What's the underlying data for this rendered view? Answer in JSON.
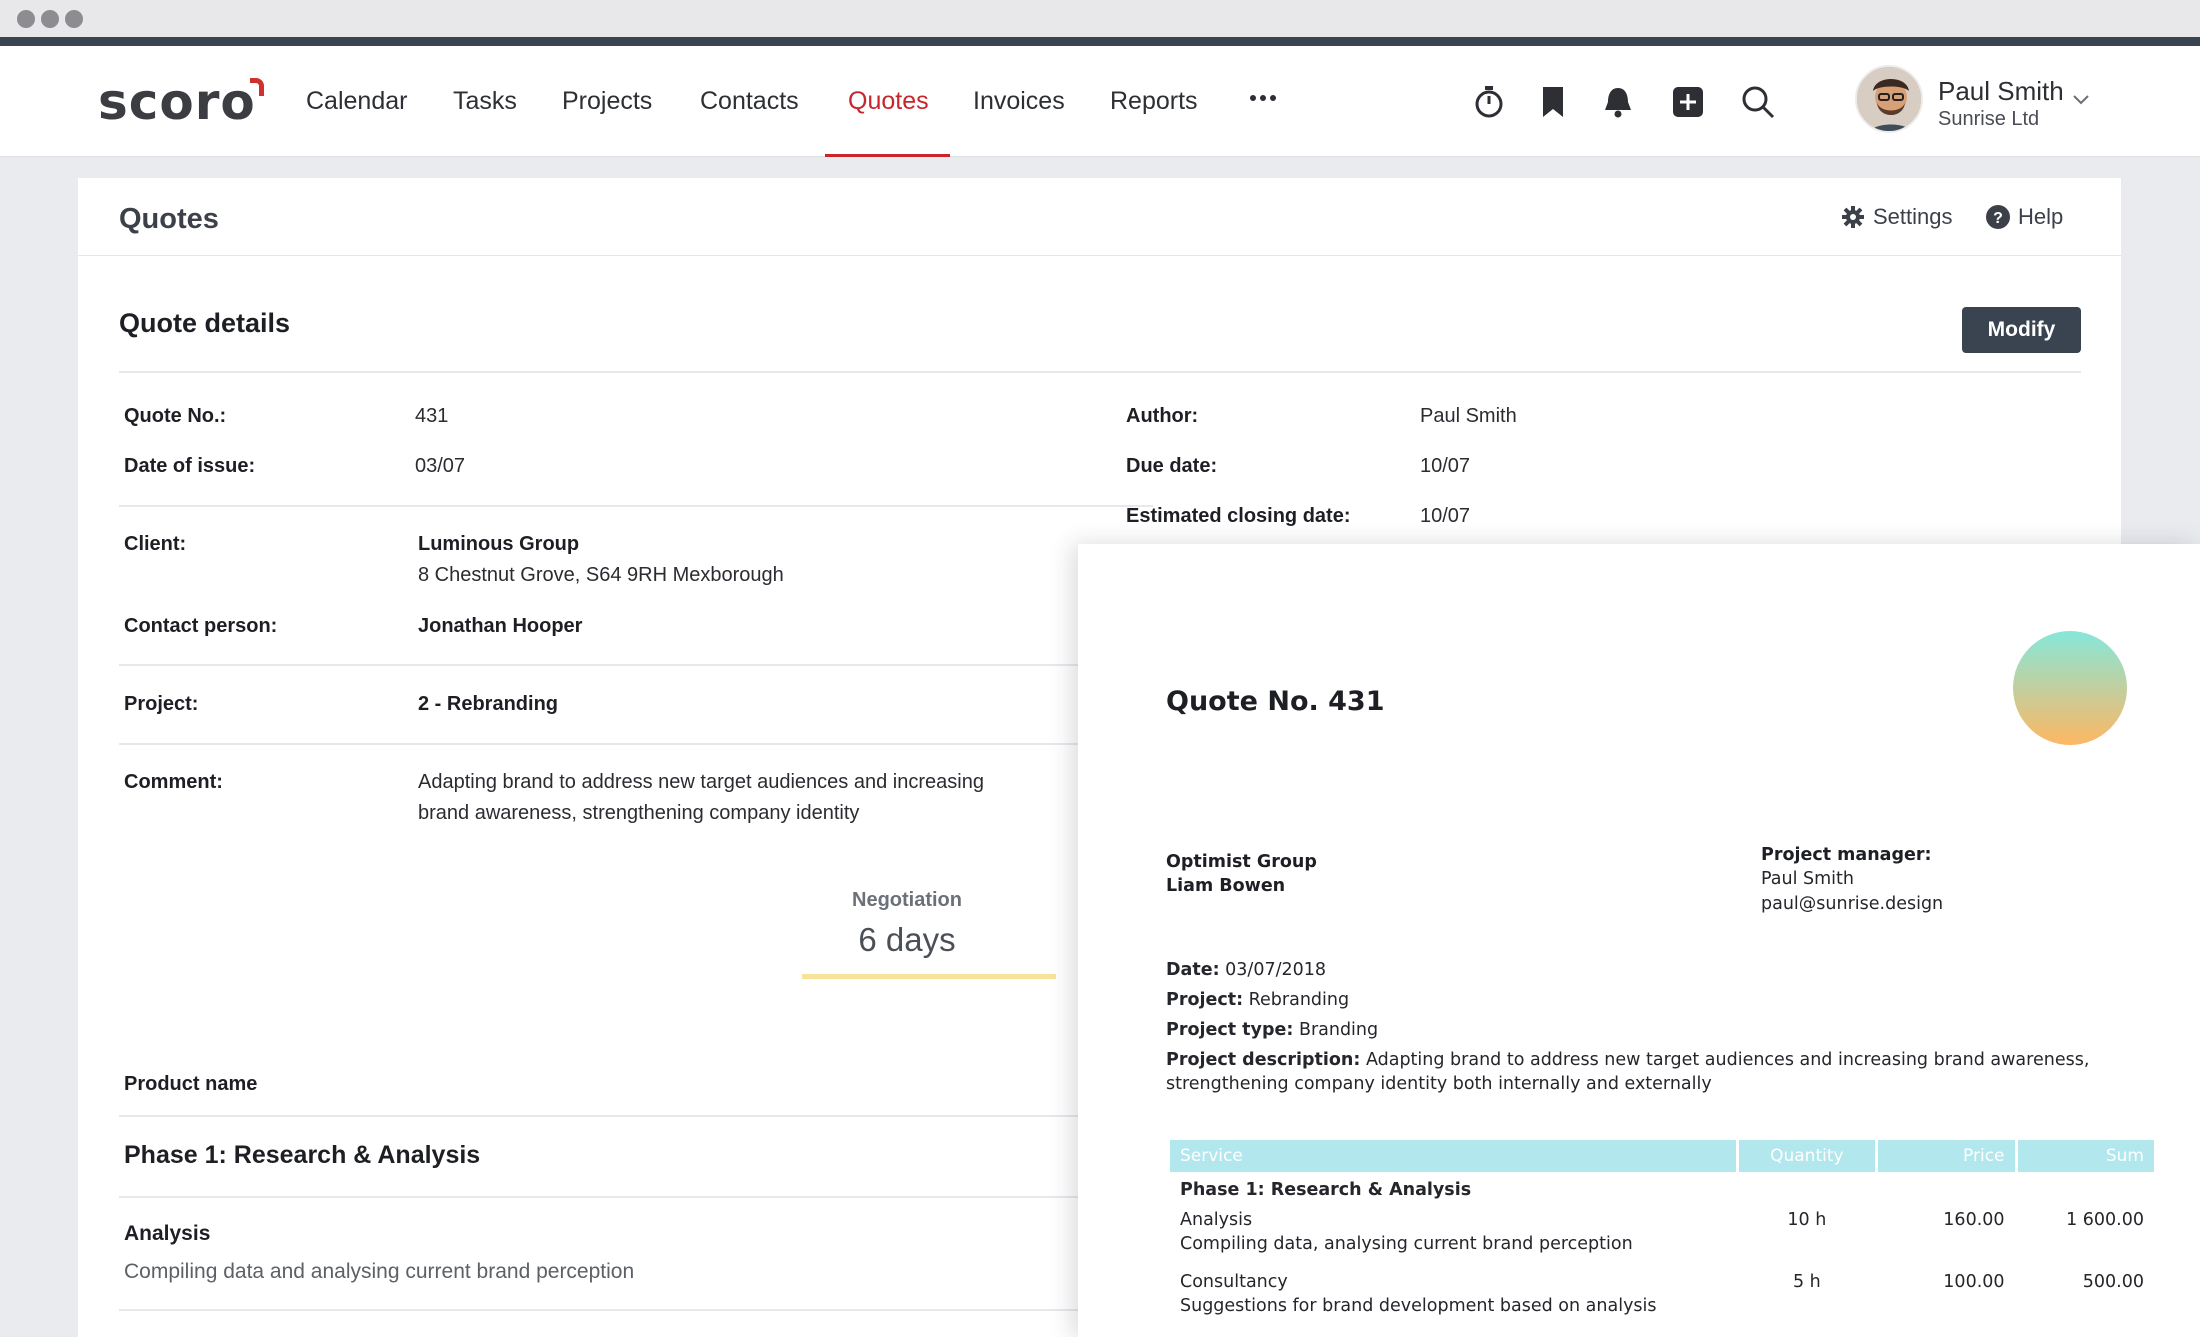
{
  "app": {
    "logo": "scoro"
  },
  "nav": {
    "items": [
      {
        "label": "Calendar"
      },
      {
        "label": "Tasks"
      },
      {
        "label": "Projects"
      },
      {
        "label": "Contacts"
      },
      {
        "label": "Quotes",
        "active": true
      },
      {
        "label": "Invoices"
      },
      {
        "label": "Reports"
      }
    ],
    "more_icon": "ellipsis-icon",
    "tools": [
      "timer-icon",
      "bookmark-icon",
      "bell-icon",
      "add-icon",
      "search-icon"
    ]
  },
  "user": {
    "name": "Paul Smith",
    "company": "Sunrise Ltd"
  },
  "page": {
    "title": "Quotes",
    "settings_label": "Settings",
    "help_label": "Help"
  },
  "details": {
    "title": "Quote details",
    "modify_label": "Modify",
    "quote_no_label": "Quote No.:",
    "quote_no": "431",
    "date_of_issue_label": "Date of issue:",
    "date_of_issue": "03/07",
    "author_label": "Author:",
    "author": "Paul Smith",
    "due_date_label": "Due date:",
    "due_date": "10/07",
    "closing_label": "Estimated closing date:",
    "closing_date": "10/07",
    "client_label": "Client:",
    "client_name": "Luminous Group",
    "client_address": "8 Chestnut Grove, S64 9RH Mexborough",
    "contact_label": "Contact person:",
    "contact": "Jonathan Hooper",
    "project_label": "Project:",
    "project": "2 - Rebranding",
    "comment_label": "Comment:",
    "comment_line1": "Adapting brand to address new target audiences and increasing",
    "comment_line2": "brand awareness, strengthening company identity",
    "stage_label": "Negotiation",
    "stage_value": "6 days",
    "product_header": "Product name",
    "phase_title": "Phase 1: Research & Analysis",
    "item_title": "Analysis",
    "item_desc": "Compiling data and analysing current brand perception"
  },
  "document": {
    "title": "Quote No. 431",
    "client": "Optimist Group",
    "client_contact": "Liam Bowen",
    "pm_label": "Project manager:",
    "pm_name": "Paul Smith",
    "pm_email": "paul@sunrise.design",
    "date_label": "Date:",
    "date": "03/07/2018",
    "project_label": "Project:",
    "project": "Rebranding",
    "type_label": "Project type:",
    "type": "Branding",
    "desc_label": "Project description:",
    "desc": "Adapting brand to address new target audiences and increasing brand awareness, strengthening company identity both internally and externally",
    "table": {
      "headers": [
        "Service",
        "Quantity",
        "Price",
        "Sum"
      ],
      "phase": "Phase 1: Research & Analysis",
      "rows": [
        {
          "service": "Analysis",
          "desc": "Compiling data, analysing current brand perception",
          "quantity": "10 h",
          "price": "160.00",
          "sum": "1 600.00"
        },
        {
          "service": "Consultancy",
          "desc": "Suggestions for brand development based on analysis",
          "quantity": "5 h",
          "price": "100.00",
          "sum": "500.00"
        }
      ]
    }
  }
}
